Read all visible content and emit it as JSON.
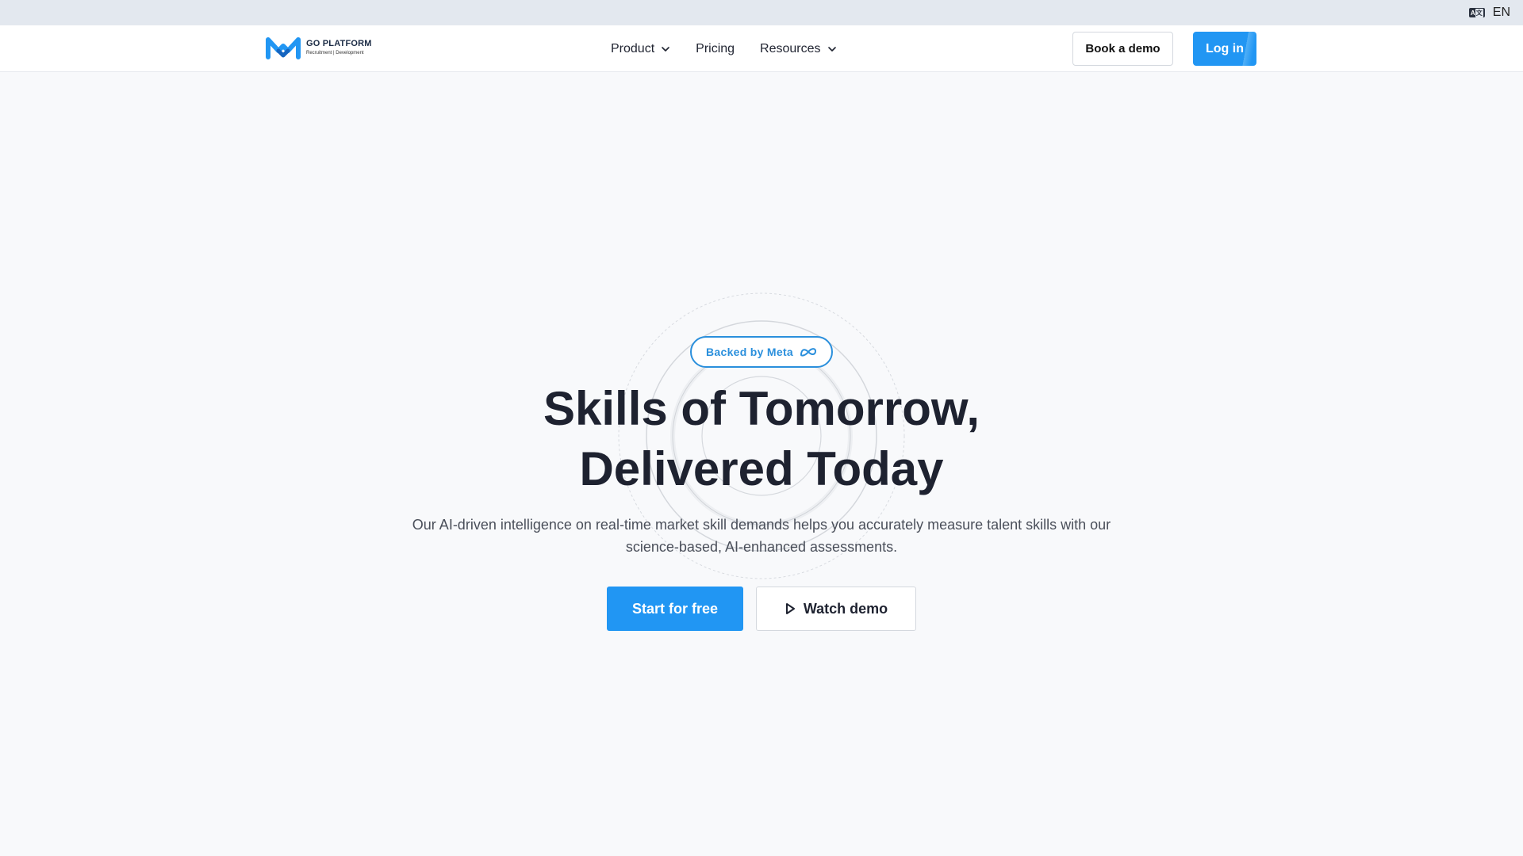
{
  "utility_bar": {
    "language_icon": "translate-icon",
    "language": "EN"
  },
  "nav": {
    "logo": {
      "title": "GO PLATFORM",
      "subtitle": "Recruitment | Development"
    },
    "links": [
      {
        "label": "Product",
        "has_dropdown": true
      },
      {
        "label": "Pricing",
        "has_dropdown": false
      },
      {
        "label": "Resources",
        "has_dropdown": true
      }
    ],
    "book_demo_label": "Book a demo",
    "login_label": "Log in"
  },
  "hero": {
    "badge": "Backed by Meta",
    "badge_icon": "meta-logo-icon",
    "title_line1": "Skills of Tomorrow,",
    "title_line2": "Delivered Today",
    "subtitle_line1": "Our AI-driven intelligence on real-time market skill demands helps you accurately measure talent skills with our",
    "subtitle_line2": "science-based, AI-enhanced assessments.",
    "primary_cta": "Start for free",
    "secondary_cta": "Watch demo",
    "secondary_cta_icon": "play-icon"
  },
  "colors": {
    "brand_blue": "#2196f3",
    "badge_blue": "#2a8fdc",
    "heading": "#1e2230",
    "page_background": "#f8f9fb",
    "utility_bar": "#e3e8ef"
  }
}
